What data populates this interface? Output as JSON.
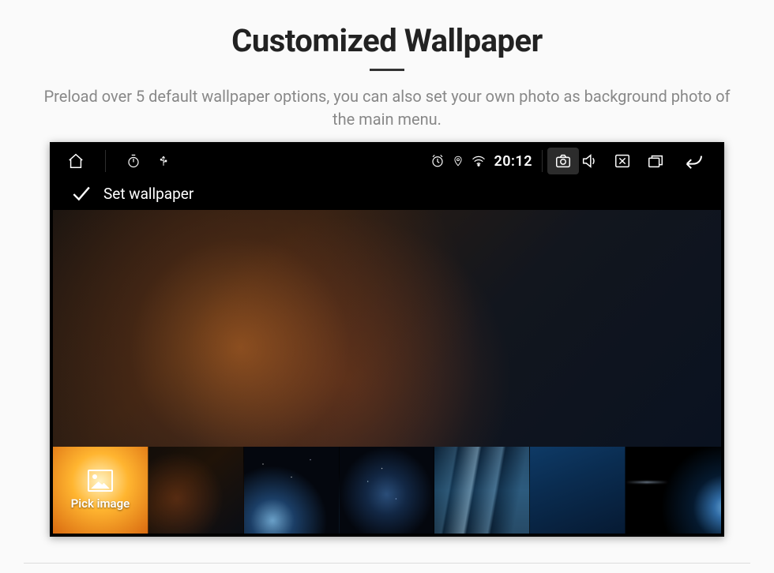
{
  "heading": "Customized Wallpaper",
  "subheading": "Preload over 5 default wallpaper options, you can also set your own photo as background photo of the main menu.",
  "statusbar": {
    "clock": "20:12"
  },
  "screen": {
    "title": "Set wallpaper",
    "pick_label": "Pick image"
  }
}
